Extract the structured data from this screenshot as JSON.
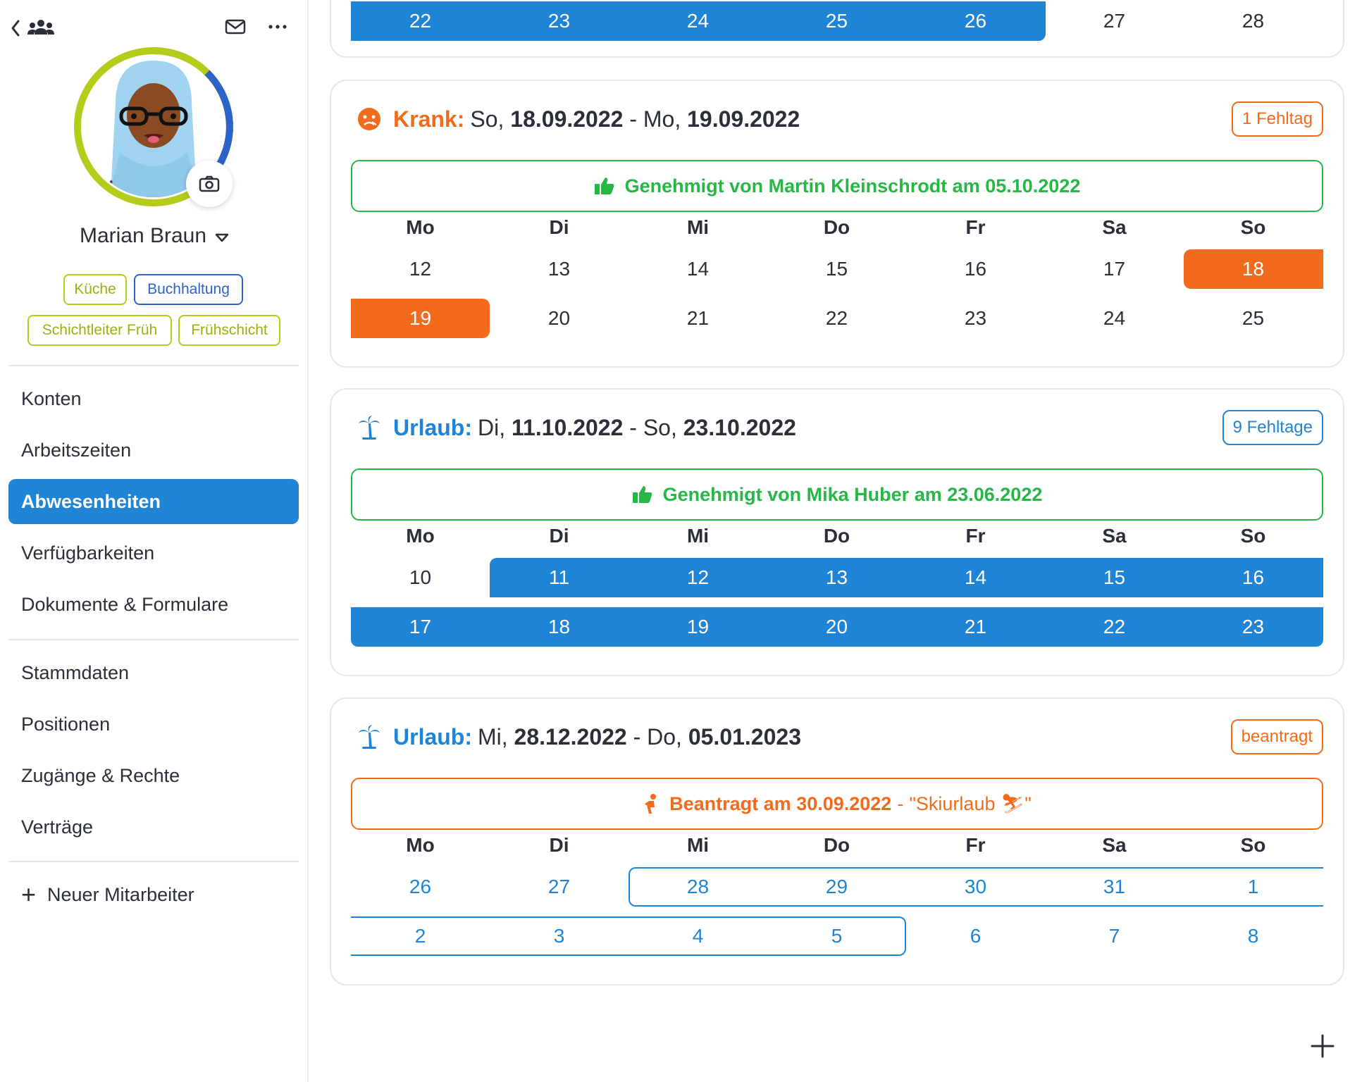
{
  "sidebar": {
    "profile": {
      "name": "Marian Braun"
    },
    "tags": [
      "Küche",
      "Buchhaltung",
      "Schichtleiter Früh",
      "Frühschicht"
    ],
    "nav_group1": [
      "Konten",
      "Arbeitszeiten",
      "Abwesenheiten",
      "Verfügbarkeiten",
      "Dokumente & Formulare"
    ],
    "nav_group2": [
      "Stammdaten",
      "Positionen",
      "Zugänge & Rechte",
      "Verträge"
    ],
    "new_employee": "Neuer Mitarbeiter",
    "active_item": "Abwesenheiten"
  },
  "colors": {
    "primary_blue": "#1f84d6",
    "orange": "#f26b1d",
    "green": "#27b745",
    "tag_green": "#b5cc1a",
    "tag_blue": "#2e63c9"
  },
  "top_partial": {
    "days": [
      "22",
      "23",
      "24",
      "25",
      "26",
      "27",
      "28"
    ]
  },
  "weekday_headers": [
    "Mo",
    "Di",
    "Mi",
    "Do",
    "Fr",
    "Sa",
    "So"
  ],
  "absences": [
    {
      "type": "Krank:",
      "icon": "sick-face-icon",
      "from_day": "So,",
      "from_date": "18.09.2022",
      "sep": "-",
      "to_day": "Mo,",
      "to_date": "19.09.2022",
      "badge": "1 Fehltag",
      "status": "Genehmigt von Martin Kleinschrodt am 05.10.2022",
      "week1": [
        "12",
        "13",
        "14",
        "15",
        "16",
        "17",
        "18"
      ],
      "week2": [
        "19",
        "20",
        "21",
        "22",
        "23",
        "24",
        "25"
      ]
    },
    {
      "type": "Urlaub:",
      "icon": "palm-tree-icon",
      "from_day": "Di,",
      "from_date": "11.10.2022",
      "sep": "-",
      "to_day": "So,",
      "to_date": "23.10.2022",
      "badge": "9 Fehltage",
      "status": "Genehmigt von Mika Huber am 23.06.2022",
      "week1": [
        "10",
        "11",
        "12",
        "13",
        "14",
        "15",
        "16"
      ],
      "week2": [
        "17",
        "18",
        "19",
        "20",
        "21",
        "22",
        "23"
      ]
    },
    {
      "type": "Urlaub:",
      "icon": "palm-tree-icon",
      "from_day": "Mi,",
      "from_date": "28.12.2022",
      "sep": "-",
      "to_day": "Do,",
      "to_date": "05.01.2023",
      "badge": "beantragt",
      "status": "Beantragt am 30.09.2022",
      "status_sep": "-",
      "status_note": "\"Skiurlaub ⛷\"",
      "week1": [
        "26",
        "27",
        "28",
        "29",
        "30",
        "31",
        "1"
      ],
      "week2": [
        "2",
        "3",
        "4",
        "5",
        "6",
        "7",
        "8"
      ]
    }
  ]
}
